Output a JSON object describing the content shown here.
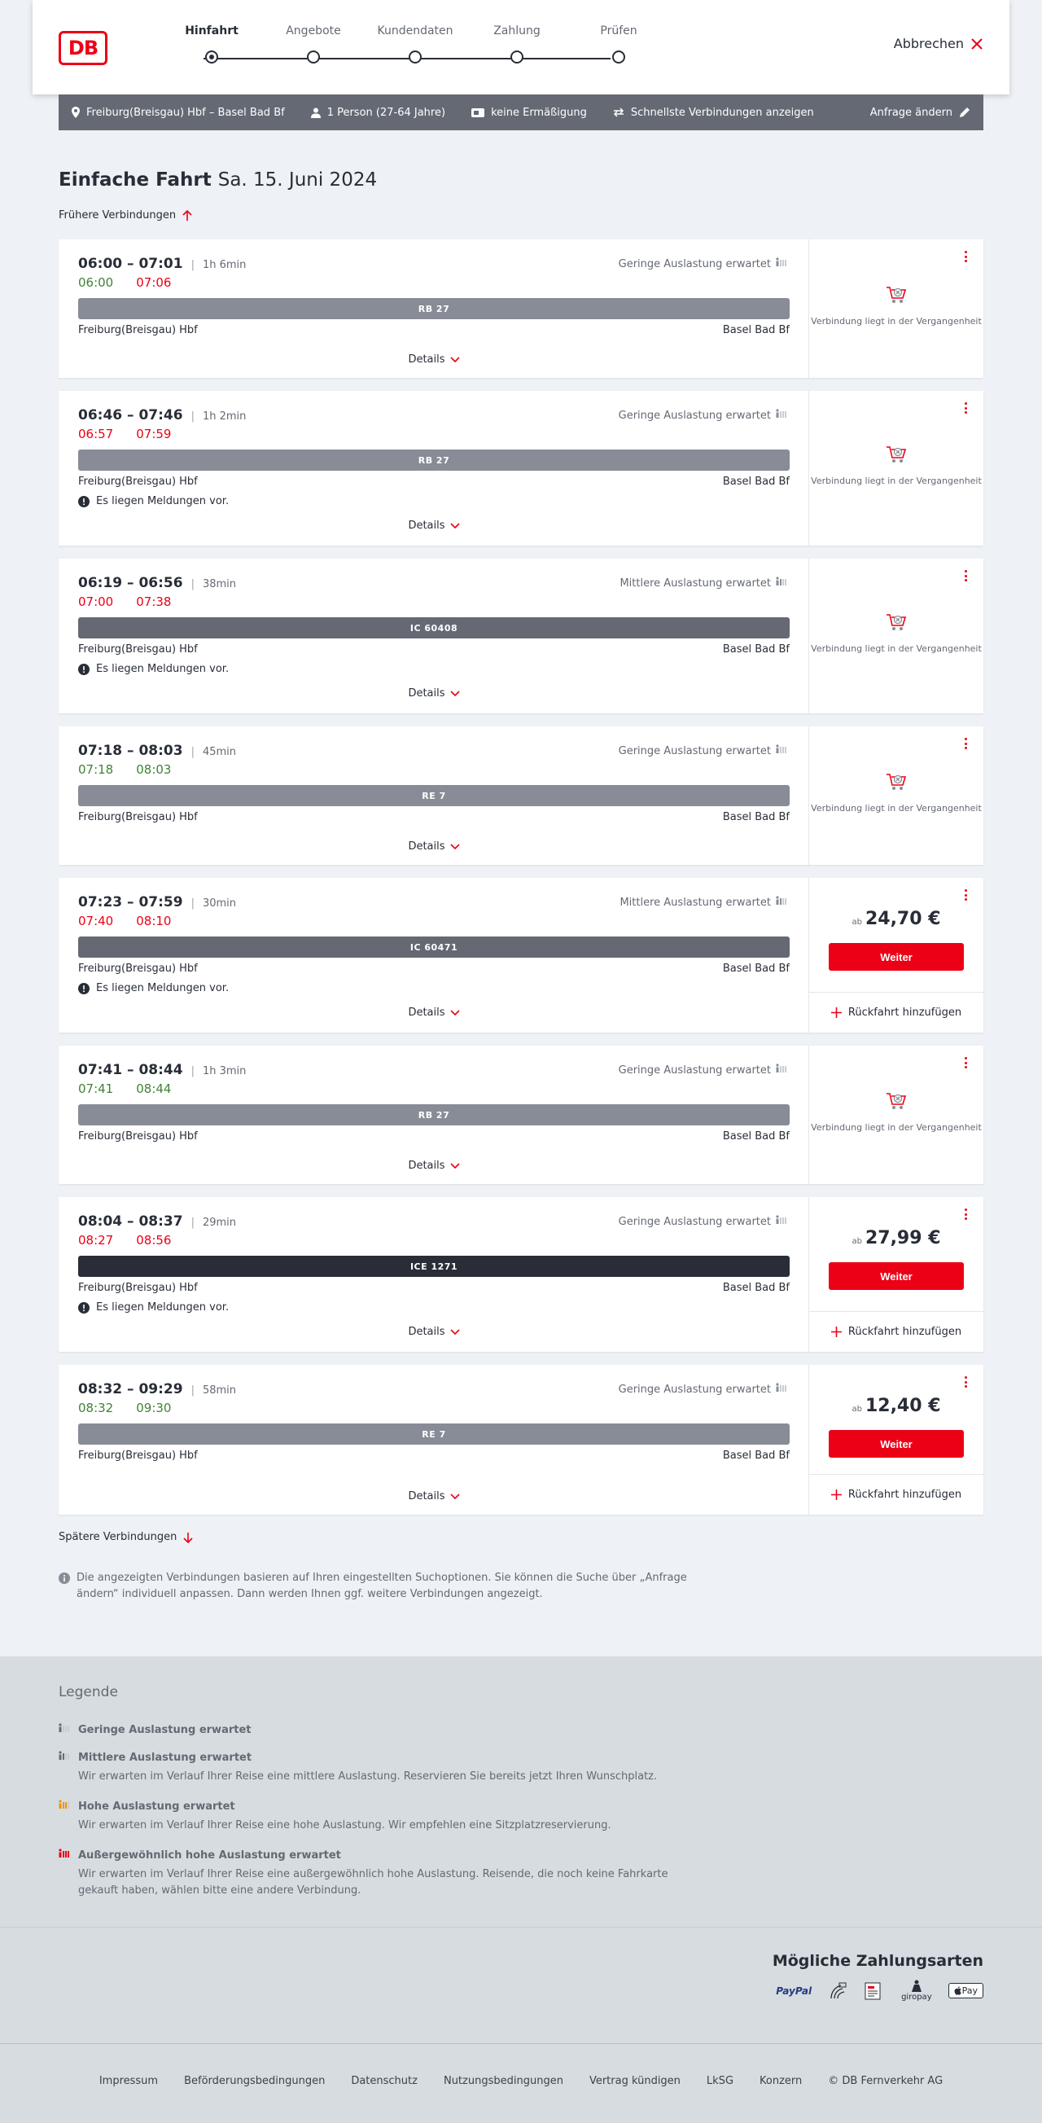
{
  "header": {
    "logo": "DB",
    "steps": [
      "Hinfahrt",
      "Angebote",
      "Kundendaten",
      "Zahlung",
      "Prüfen"
    ],
    "cancel": "Abbrechen"
  },
  "filter": {
    "route": "Freiburg(Breisgau) Hbf – Basel Bad Bf",
    "travelers": "1 Person (27-64 Jahre)",
    "discount": "keine Ermäßigung",
    "fastest": "Schnellste Verbindungen anzeigen",
    "change": "Anfrage ändern"
  },
  "title": {
    "main": "Einfache Fahrt",
    "date": "Sa. 15. Juni 2024"
  },
  "earlier": "Frühere Verbindungen",
  "later": "Spätere Verbindungen",
  "labels": {
    "details": "Details",
    "notice": "Es liegen Meldungen vor.",
    "past": "Verbindung liegt in der Vergangenheit",
    "price_prefix": "ab",
    "weiter": "Weiter",
    "return": "Rückfahrt hinzufügen"
  },
  "connections": [
    {
      "time": "06:00 – 07:01",
      "duration": "1h 6min",
      "rt_dep": "06:00",
      "rt_arr": "07:06",
      "dep_state": "on-time",
      "arr_state": "late",
      "load": "Geringe Auslastung erwartet",
      "train": "RB 27",
      "from": "Freiburg(Breisgau) Hbf",
      "to": "Basel Bad Bf",
      "notice": false,
      "price": ""
    },
    {
      "time": "06:46 – 07:46",
      "duration": "1h 2min",
      "rt_dep": "06:57",
      "rt_arr": "07:59",
      "dep_state": "late",
      "arr_state": "late",
      "load": "Geringe Auslastung erwartet",
      "train": "RB 27",
      "from": "Freiburg(Breisgau) Hbf",
      "to": "Basel Bad Bf",
      "notice": true,
      "price": ""
    },
    {
      "time": "06:19 – 06:56",
      "duration": "38min",
      "rt_dep": "07:00",
      "rt_arr": "07:38",
      "dep_state": "late",
      "arr_state": "late",
      "load": "Mittlere Auslastung erwartet",
      "train": "IC 60408",
      "from": "Freiburg(Breisgau) Hbf",
      "to": "Basel Bad Bf",
      "notice": true,
      "price": ""
    },
    {
      "time": "07:18 – 08:03",
      "duration": "45min",
      "rt_dep": "07:18",
      "rt_arr": "08:03",
      "dep_state": "on-time",
      "arr_state": "on-time",
      "load": "Geringe Auslastung erwartet",
      "train": "RE 7",
      "from": "Freiburg(Breisgau) Hbf",
      "to": "Basel Bad Bf",
      "notice": false,
      "price": ""
    },
    {
      "time": "07:23 – 07:59",
      "duration": "30min",
      "rt_dep": "07:40",
      "rt_arr": "08:10",
      "dep_state": "late",
      "arr_state": "late",
      "load": "Mittlere Auslastung erwartet",
      "train": "IC 60471",
      "from": "Freiburg(Breisgau) Hbf",
      "to": "Basel Bad Bf",
      "notice": true,
      "price": "24,70 €"
    },
    {
      "time": "07:41 – 08:44",
      "duration": "1h 3min",
      "rt_dep": "07:41",
      "rt_arr": "08:44",
      "dep_state": "on-time",
      "arr_state": "on-time",
      "load": "Geringe Auslastung erwartet",
      "train": "RB 27",
      "from": "Freiburg(Breisgau) Hbf",
      "to": "Basel Bad Bf",
      "notice": false,
      "price": ""
    },
    {
      "time": "08:04 – 08:37",
      "duration": "29min",
      "rt_dep": "08:27",
      "rt_arr": "08:56",
      "dep_state": "late",
      "arr_state": "late",
      "load": "Geringe Auslastung erwartet",
      "train": "ICE 1271",
      "from": "Freiburg(Breisgau) Hbf",
      "to": "Basel Bad Bf",
      "notice": true,
      "price": "27,99 €"
    },
    {
      "time": "08:32 – 09:29",
      "duration": "58min",
      "rt_dep": "08:32",
      "rt_arr": "09:30",
      "dep_state": "on-time",
      "arr_state": "on-time",
      "load": "Geringe Auslastung erwartet",
      "train": "RE 7",
      "from": "Freiburg(Breisgau) Hbf",
      "to": "Basel Bad Bf",
      "notice": false,
      "price": "12,40 €"
    }
  ],
  "info": "Die angezeigten Verbindungen basieren auf Ihren eingestellten Suchoptionen. Sie können die Suche über „Anfrage ändern“ individuell anpassen. Dann werden Ihnen ggf. weitere Verbindungen angezeigt.",
  "legend": {
    "title": "Legende",
    "items": [
      {
        "head": "Geringe Auslastung erwartet",
        "desc": ""
      },
      {
        "head": "Mittlere Auslastung erwartet",
        "desc": "Wir erwarten im Verlauf Ihrer Reise eine mittlere Auslastung. Reservieren Sie bereits jetzt Ihren Wunschplatz."
      },
      {
        "head": "Hohe Auslastung erwartet",
        "desc": "Wir erwarten im Verlauf Ihrer Reise eine hohe Auslastung. Wir empfehlen eine Sitzplatzreservierung."
      },
      {
        "head": "Außergewöhnlich hohe Auslastung erwartet",
        "desc": "Wir erwarten im Verlauf Ihrer Reise eine außergewöhnlich hohe Auslastung. Reisende, die noch keine Fahrkarte gekauft haben, wählen bitte eine andere Verbindung."
      }
    ]
  },
  "payment": {
    "title": "Mögliche Zahlungsarten",
    "paypal": "PayPal",
    "giropay": "giropay",
    "applepay": "Pay"
  },
  "footer": [
    "Impressum",
    "Beförderungsbedingungen",
    "Datenschutz",
    "Nutzungsbedingungen",
    "Vertrag kündigen",
    "LkSG",
    "Konzern",
    "© DB Fernverkehr AG"
  ],
  "colors": {
    "brand": "#ec0016",
    "on_time": "#408335",
    "late": "#ec0016",
    "legend_high": "#f39200"
  }
}
